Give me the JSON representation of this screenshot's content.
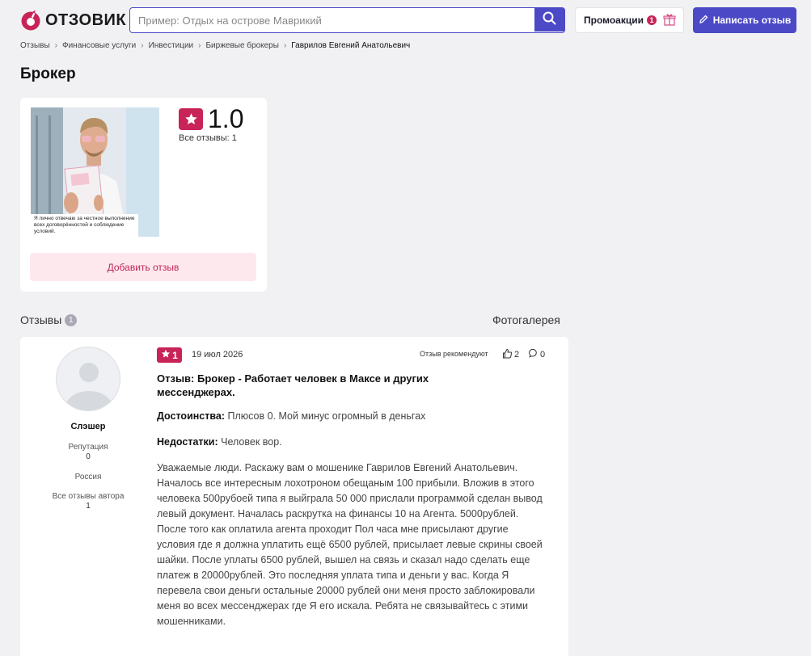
{
  "header": {
    "logo_text": "ОТЗОВИК",
    "search_placeholder": "Пример: Отдых на острове Маврикий",
    "promo_label": "Промоакции",
    "promo_count": "1",
    "write_review_label": "Написать отзыв"
  },
  "breadcrumb": {
    "items": [
      "Отзывы",
      "Финансовые услуги",
      "Инвестиции",
      "Биржевые брокеры"
    ],
    "current": "Гаврилов Евгений Анатольевич"
  },
  "page": {
    "title": "Брокер"
  },
  "product": {
    "photo_caption": "Я лично отвечаю за честное выполнение всех договорённостей и соблюдение условий.",
    "rating": "1.0",
    "reviews_count_text": "Все отзывы: 1",
    "add_review_label": "Добавить отзыв"
  },
  "reviews_section": {
    "heading": "Отзывы",
    "count": "1",
    "gallery_label": "Фотогалерея"
  },
  "review": {
    "stars": "1",
    "date": "19 июл 2026",
    "recommend_label": "Отзыв рекомендуют",
    "likes": "2",
    "comments": "0",
    "author": {
      "name": "Слэшер",
      "reputation_label": "Репутация",
      "reputation_value": "0",
      "country": "Россия",
      "all_reviews_label": "Все отзывы автора",
      "all_reviews_value": "1"
    },
    "title": "Отзыв: Брокер - Работает человек в Максе и других мессенджерах.",
    "pros_label": "Достоинства:",
    "pros_text": "Плюсов 0. Мой минус огромный в деньгах",
    "cons_label": "Недостатки:",
    "cons_text": "Человек вор.",
    "body": "Уважаемые люди. Раскажу вам о мошенике Гаврилов Евгений Анатольевич. Началось все интересным лохотроном обещаным 100 прибыли. Вложив в этого человека 500рубоей типа я выйграла 50 000 прислали программой сделан вывод левый документ. Началась раскрутка на финансы 10 на Агента. 5000рублей. После того как оплатила агента проходит Пол часа мне присылают другие условия где я должна уплатить ещё 6500 рублей, присылает левые скрины своей шайки. После уплаты 6500 рублей, вышел на связь и сказал надо сделать еще платеж в 20000рублей. Это последняя уплата типа и деньги у вас. Когда Я перевела свои деньги остальные 20000 рублей они меня просто заблокировали меня во всех мессенджерах где Я его искала. Ребята не связывайтесь с этими мошенниками."
  },
  "colors": {
    "brand_blue": "#4b49c6",
    "brand_red": "#c82458",
    "page_bg": "#f1f1f4"
  }
}
